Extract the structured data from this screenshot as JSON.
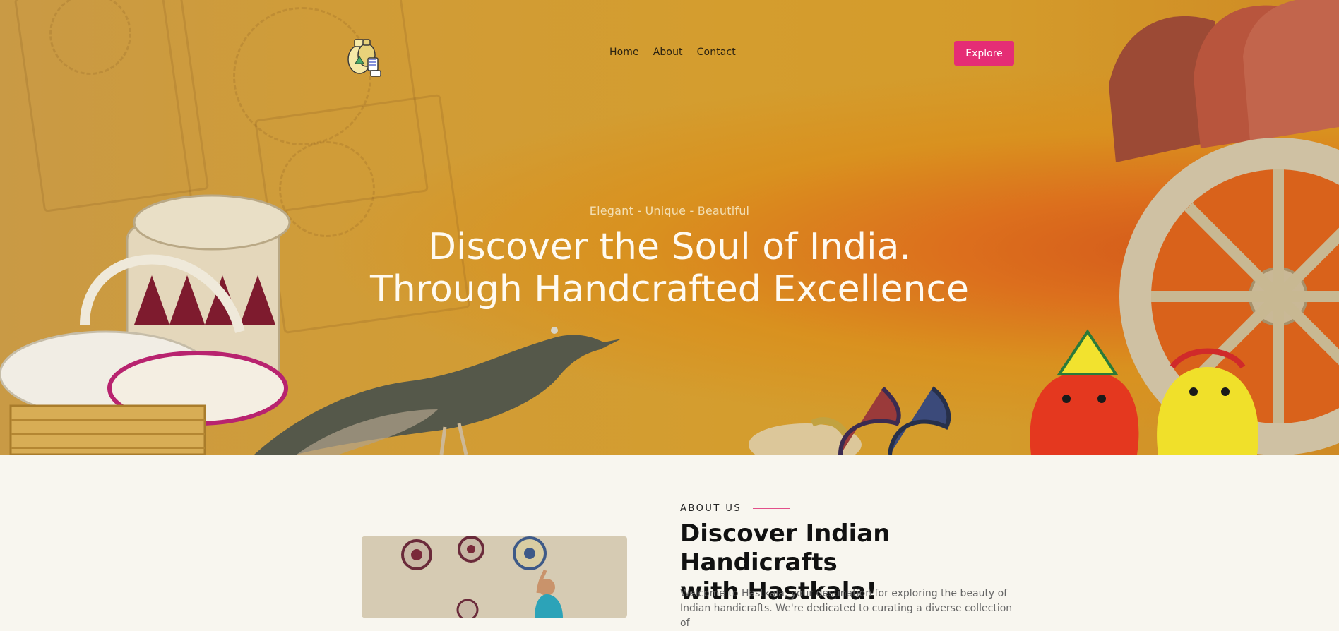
{
  "nav": {
    "logo_alt": "Hastkala logo",
    "links": [
      "Home",
      "About",
      "Contact"
    ],
    "cta_label": "Explore"
  },
  "hero": {
    "tagline": "Elegant - Unique - Beautiful",
    "headline_line1": "Discover the Soul of India.",
    "headline_line2": "Through Handcrafted Excellence"
  },
  "about": {
    "eyebrow": "ABOUT US",
    "title_line1": "Discover Indian Handicrafts",
    "title_line2": "with Hastkala!",
    "body": "Welcome to Hastkala, your destination for exploring the beauty of Indian handicrafts. We're dedicated to curating a diverse collection of"
  },
  "colors": {
    "accent": "#e52d75",
    "hero_bg": "#d49d2e",
    "page_bg": "#f8f6ef"
  },
  "icons": [
    "logo-pottery-icon"
  ]
}
